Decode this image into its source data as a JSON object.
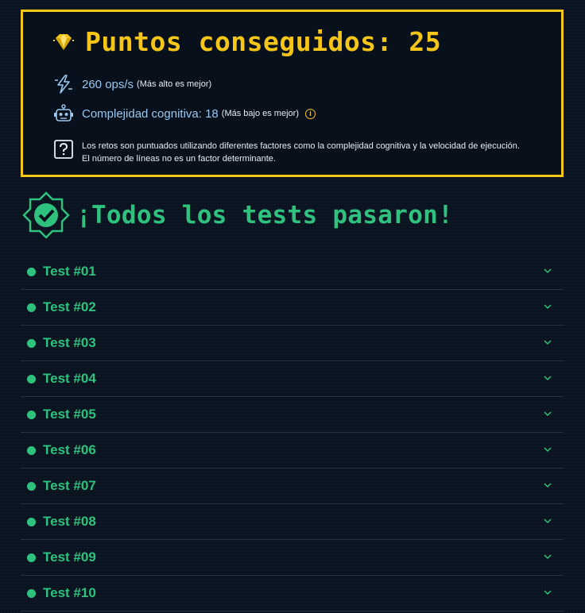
{
  "score": {
    "title": "Puntos conseguidos: 25",
    "ops_value": "260 ops/s",
    "ops_note": "(Más alto es mejor)",
    "complexity_value": "Complejidad cognitiva: 18",
    "complexity_note": "(Más bajo es mejor)",
    "info_glyph": "i",
    "help_text": "Los retos son puntuados utilizando diferentes factores como la complejidad cognitiva y la velocidad de ejecución. El número de líneas no es un factor determinante."
  },
  "result": {
    "title": "¡Todos los tests pasaron!"
  },
  "tests": [
    {
      "label": "Test #01"
    },
    {
      "label": "Test #02"
    },
    {
      "label": "Test #03"
    },
    {
      "label": "Test #04"
    },
    {
      "label": "Test #05"
    },
    {
      "label": "Test #06"
    },
    {
      "label": "Test #07"
    },
    {
      "label": "Test #08"
    },
    {
      "label": "Test #09"
    },
    {
      "label": "Test #10"
    }
  ],
  "colors": {
    "accent": "#f5c518",
    "success": "#2ec27e",
    "link": "#9ac8f0",
    "background": "#0a1320"
  },
  "icons": {
    "score": "gem-icon",
    "speed": "lightning-icon",
    "complexity": "robot-icon",
    "help": "question-icon",
    "passed": "check-badge-icon",
    "expand": "chevron-down-icon"
  }
}
